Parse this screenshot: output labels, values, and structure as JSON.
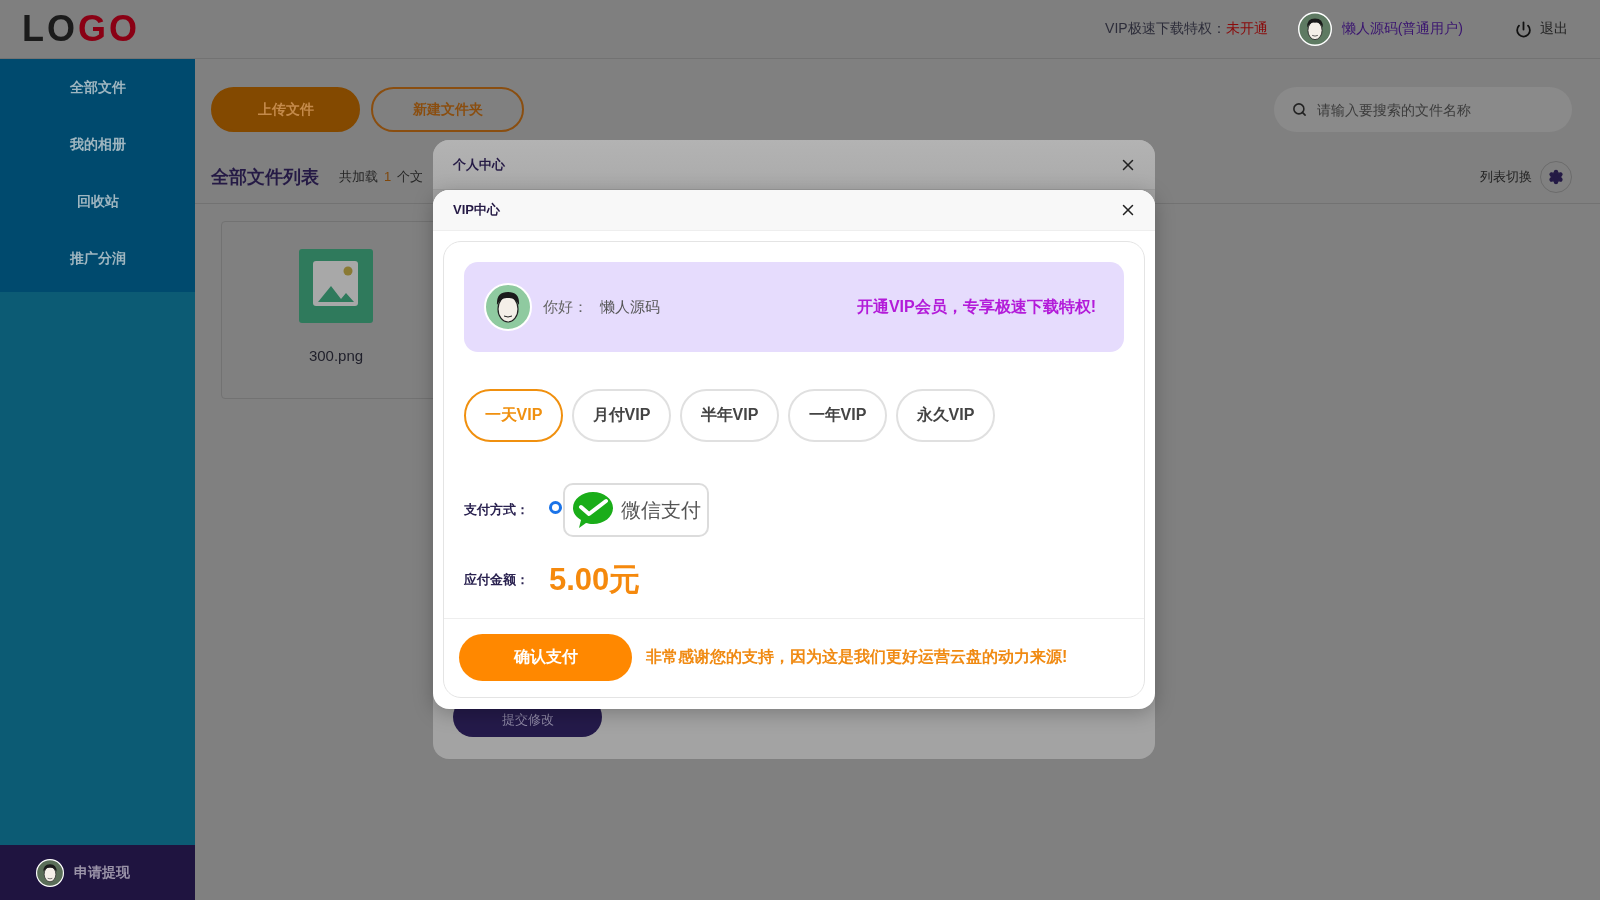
{
  "header": {
    "logo": [
      {
        "text": "LO",
        "color": "#1b1b1b"
      },
      {
        "text": "GO",
        "color": "#8a0014"
      }
    ],
    "vip_status_label": "VIP极速下载特权：",
    "vip_status": "未开通",
    "user": "懒人源码(普通用户)",
    "logout": "退出"
  },
  "sidebar": {
    "items": [
      {
        "label": "全部文件"
      },
      {
        "label": "我的相册"
      },
      {
        "label": "回收站"
      },
      {
        "label": "推广分润"
      }
    ],
    "footer": "申请提现"
  },
  "toolbar": {
    "buttons": [
      {
        "label": "上传文件",
        "kind": "filled"
      },
      {
        "label": "新建文件夹",
        "kind": "outline"
      }
    ],
    "search": {
      "placeholder": "请输入要搜索的文件名称"
    }
  },
  "list_header": {
    "title": "全部文件列表",
    "count_prefix": "共加载",
    "count": "1",
    "count_suffix": "个文",
    "view_toggle": "列表切换"
  },
  "files": [
    {
      "name": "300.png"
    }
  ],
  "profile_dialog": {
    "title": "个人中心",
    "submit": "提交修改"
  },
  "vip_dialog": {
    "title": "VIP中心",
    "greeting_label": "你好：",
    "username": "懒人源码",
    "promo": "开通VIP会员，专享极速下载特权!",
    "plans": [
      {
        "label": "一天VIP",
        "selected": true
      },
      {
        "label": "月付VIP",
        "selected": false
      },
      {
        "label": "半年VIP",
        "selected": false
      },
      {
        "label": "一年VIP",
        "selected": false
      },
      {
        "label": "永久VIP",
        "selected": false
      }
    ],
    "payment_label": "支付方式：",
    "payment_methods": [
      {
        "label": "微信支付",
        "selected": true
      }
    ],
    "amount_label": "应付金额：",
    "amount": "5.00元",
    "confirm": "确认支付",
    "thanks": "非常感谢您的支持，因为这是我们更好运营云盘的动力来源!"
  }
}
